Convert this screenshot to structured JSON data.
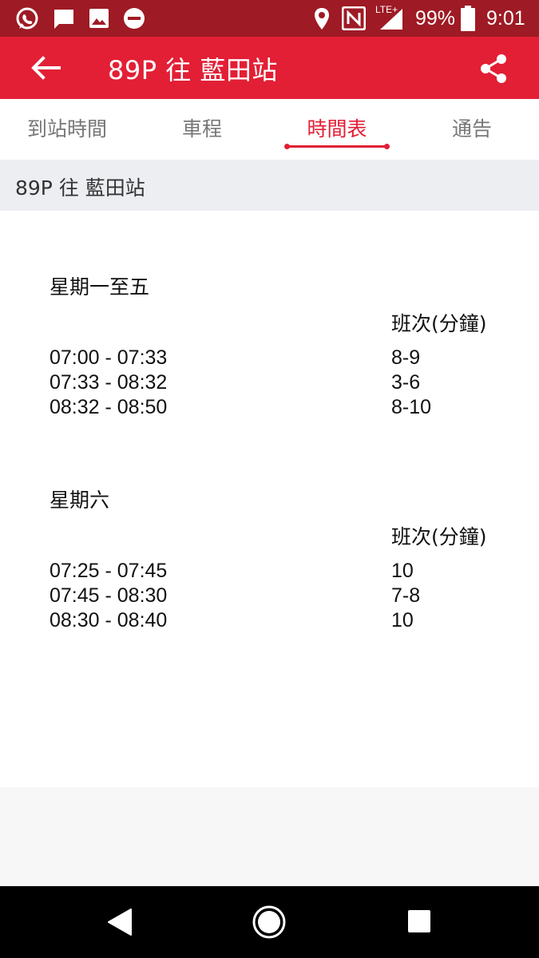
{
  "status_bar": {
    "battery": "99%",
    "time": "9:01",
    "network_label": "LTE+",
    "icons": [
      "whatsapp-icon",
      "message-icon",
      "image-icon",
      "do-not-disturb-icon",
      "location-icon",
      "nfc-icon",
      "signal-icon",
      "battery-icon"
    ]
  },
  "app_bar": {
    "title": "89P 往 藍田站"
  },
  "tabs": [
    {
      "label": "到站時間",
      "active": false
    },
    {
      "label": "車程",
      "active": false
    },
    {
      "label": "時間表",
      "active": true
    },
    {
      "label": "通告",
      "active": false
    }
  ],
  "route_header": "89P 往 藍田站",
  "timetable": [
    {
      "day": "星期一至五",
      "freq_header": "班次(分鐘)",
      "rows": [
        {
          "time": "07:00 - 07:33",
          "freq": "8-9"
        },
        {
          "time": "07:33 - 08:32",
          "freq": "3-6"
        },
        {
          "time": "08:32 - 08:50",
          "freq": "8-10"
        }
      ]
    },
    {
      "day": "星期六",
      "freq_header": "班次(分鐘)",
      "rows": [
        {
          "time": "07:25 - 07:45",
          "freq": "10"
        },
        {
          "time": "07:45 - 08:30",
          "freq": "7-8"
        },
        {
          "time": "08:30 - 08:40",
          "freq": "10"
        }
      ]
    }
  ],
  "colors": {
    "status_bar": "#9e1a24",
    "accent": "#e21f35",
    "route_header_bg": "#eceef2"
  }
}
